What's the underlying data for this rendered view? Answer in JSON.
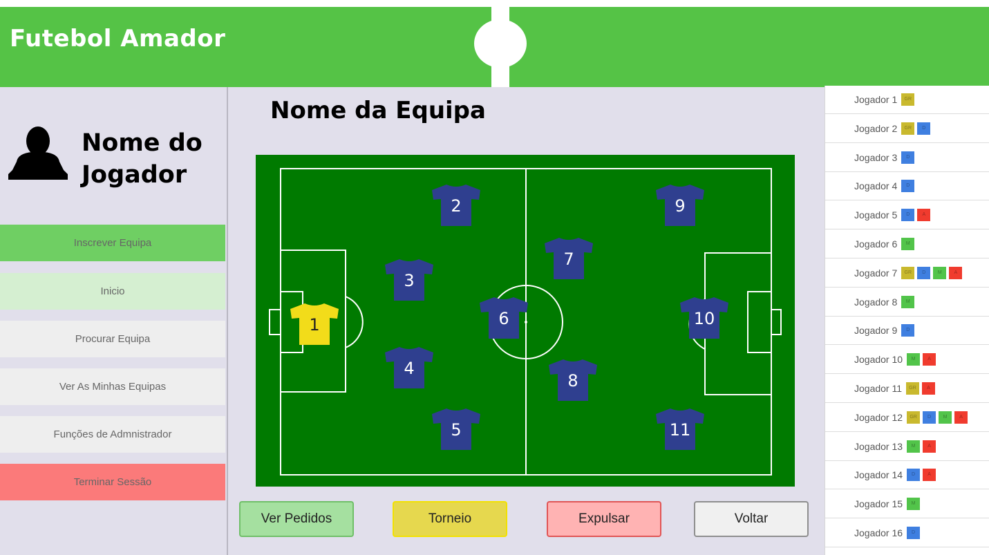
{
  "app": {
    "title": "Futebol Amador"
  },
  "profile": {
    "name": "Nome do Jogador"
  },
  "menu": [
    {
      "label": "Inscrever Equipa",
      "bg": "#6fcf63"
    },
    {
      "label": "Inicio",
      "bg": "#d5efd1"
    },
    {
      "label": "Procurar Equipa",
      "bg": "#eeeeee"
    },
    {
      "label": "Ver As Minhas Equipas",
      "bg": "#eeeeee"
    },
    {
      "label": "Funções de Admnistrador",
      "bg": "#eeeeee"
    },
    {
      "label": "Terminar Sessão",
      "bg": "#fb7a7a"
    }
  ],
  "team": {
    "name": "Nome da Equipa"
  },
  "field": {
    "players": [
      {
        "number": "1",
        "color": "#f2dc1a"
      },
      {
        "number": "2",
        "color": "#2f3f8f"
      },
      {
        "number": "3",
        "color": "#2f3f8f"
      },
      {
        "number": "4",
        "color": "#2f3f8f"
      },
      {
        "number": "5",
        "color": "#2f3f8f"
      },
      {
        "number": "6",
        "color": "#2f3f8f"
      },
      {
        "number": "7",
        "color": "#2f3f8f"
      },
      {
        "number": "8",
        "color": "#2f3f8f"
      },
      {
        "number": "9",
        "color": "#2f3f8f"
      },
      {
        "number": "10",
        "color": "#2f3f8f"
      },
      {
        "number": "11",
        "color": "#2f3f8f"
      }
    ]
  },
  "buttons": {
    "ver_pedidos": "Ver Pedidos",
    "torneio": "Torneio",
    "expulsar": "Expulsar",
    "voltar": "Voltar"
  },
  "position_colors": {
    "GR": "#c9b92e",
    "D": "#3f7fe0",
    "M": "#52c44a",
    "A": "#f03b2e"
  },
  "roster": [
    {
      "name": "Jogador 1",
      "positions": [
        "GR"
      ]
    },
    {
      "name": "Jogador 2",
      "positions": [
        "GR",
        "D"
      ]
    },
    {
      "name": "Jogador 3",
      "positions": [
        "D"
      ]
    },
    {
      "name": "Jogador 4",
      "positions": [
        "D"
      ]
    },
    {
      "name": "Jogador 5",
      "positions": [
        "D",
        "A"
      ]
    },
    {
      "name": "Jogador 6",
      "positions": [
        "M"
      ]
    },
    {
      "name": "Jogador 7",
      "positions": [
        "GR",
        "D",
        "M",
        "A"
      ]
    },
    {
      "name": "Jogador 8",
      "positions": [
        "M"
      ]
    },
    {
      "name": "Jogador 9",
      "positions": [
        "D"
      ]
    },
    {
      "name": "Jogador 10",
      "positions": [
        "M",
        "A"
      ]
    },
    {
      "name": "Jogador 11",
      "positions": [
        "GR",
        "A"
      ]
    },
    {
      "name": "Jogador 12",
      "positions": [
        "GR",
        "D",
        "M",
        "A"
      ]
    },
    {
      "name": "Jogador 13",
      "positions": [
        "M",
        "A"
      ]
    },
    {
      "name": "Jogador 14",
      "positions": [
        "D",
        "A"
      ]
    },
    {
      "name": "Jogador 15",
      "positions": [
        "M"
      ]
    },
    {
      "name": "Jogador 16",
      "positions": [
        "D"
      ]
    }
  ]
}
